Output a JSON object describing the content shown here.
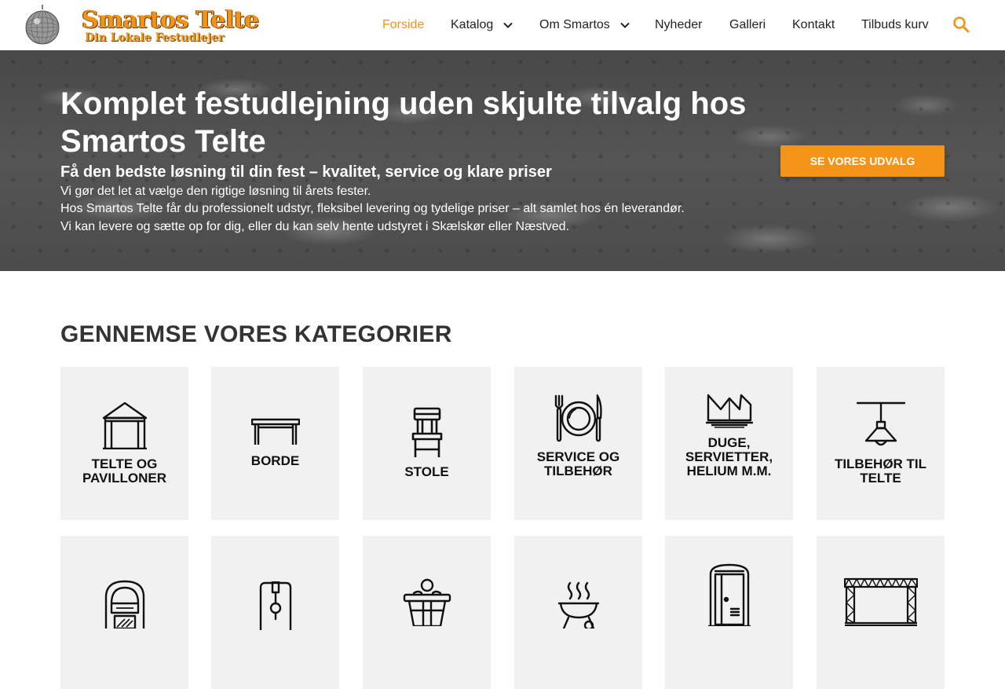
{
  "brand": {
    "name": "Smartos Telte",
    "tagline": "Din Lokale Festudlejer",
    "accent_color": "#f39418"
  },
  "nav": {
    "items": [
      {
        "label": "Forside",
        "active": true
      },
      {
        "label": "Katalog",
        "has_dropdown": true
      },
      {
        "label": "Om Smartos",
        "has_dropdown": true
      },
      {
        "label": "Nyheder"
      },
      {
        "label": "Galleri"
      },
      {
        "label": "Kontakt"
      },
      {
        "label": "Tilbuds kurv"
      }
    ],
    "search_icon": "search-icon"
  },
  "hero": {
    "title": "Komplet festudlejning uden skjulte tilvalg hos Smartos Telte",
    "subtitle": "Få den bedste løsning til din fest – kvalitet, service og klare priser",
    "lines": [
      "Vi gør det let at vælge den rigtige løsning til årets fester.",
      "Hos Smartos Telte får du professionelt udstyr, fleksibel levering og tydelige priser – alt samlet hos én leverandør.",
      "Vi kan levere og sætte op for dig, eller du kan selv hente udstyret i Skælskør eller Næstved."
    ],
    "cta_label": "SE VORES UDVALG"
  },
  "categories": {
    "heading": "GENNEMSE VORES KATEGORIER",
    "items": [
      {
        "label": "TELTE OG PAVILLONER",
        "icon": "tent-icon"
      },
      {
        "label": "BORDE",
        "icon": "table-icon"
      },
      {
        "label": "STOLE",
        "icon": "chair-icon"
      },
      {
        "label": "SERVICE OG TILBEHØR",
        "icon": "plate-cutlery-icon"
      },
      {
        "label": "DUGE, SERVIETTER, HELIUM M.M.",
        "icon": "napkin-icon"
      },
      {
        "label": "TILBEHØR TIL TELTE",
        "icon": "lamp-icon"
      },
      {
        "label": "",
        "icon": "jukebox-icon"
      },
      {
        "label": "",
        "icon": "beer-tap-icon"
      },
      {
        "label": "",
        "icon": "ice-bucket-icon"
      },
      {
        "label": "",
        "icon": "grill-icon"
      },
      {
        "label": "",
        "icon": "portable-toilet-icon"
      },
      {
        "label": "",
        "icon": "stage-truss-icon"
      }
    ]
  }
}
